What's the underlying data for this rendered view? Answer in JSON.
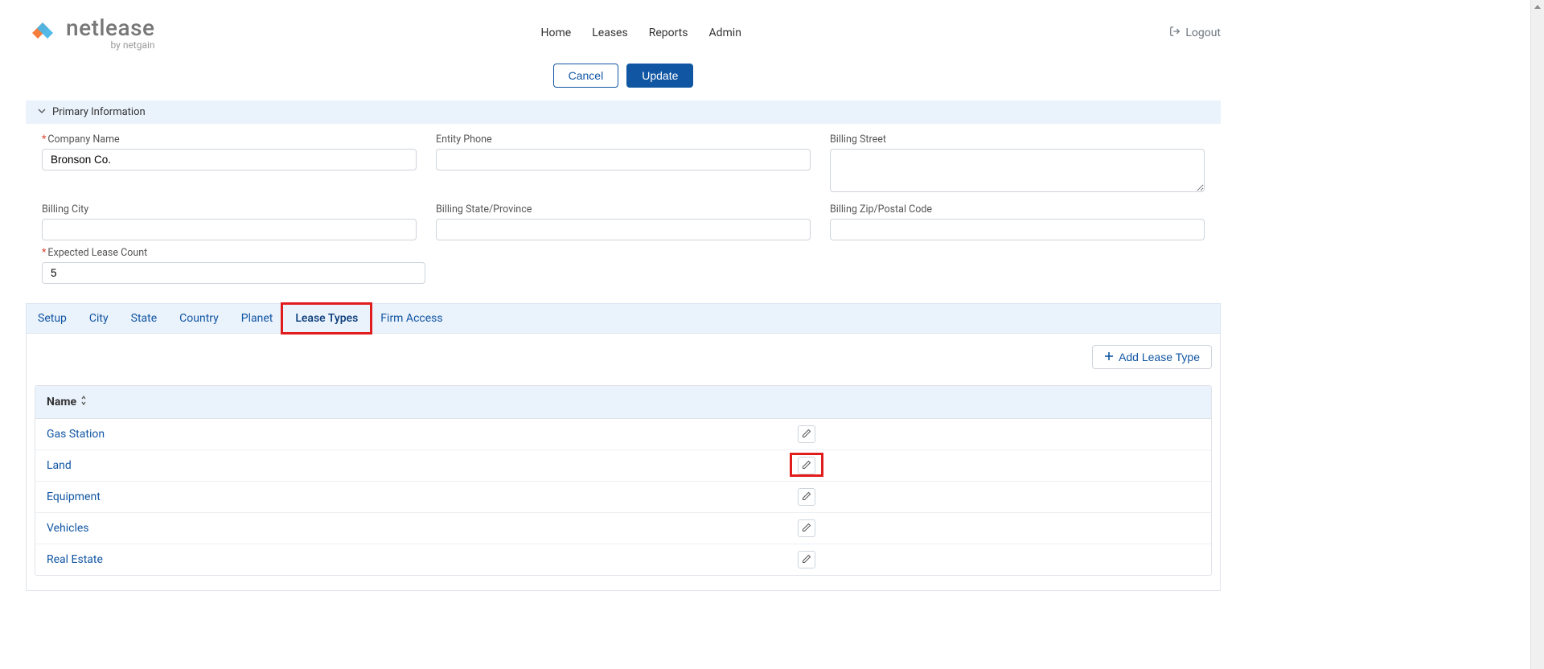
{
  "brand": {
    "name": "netlease",
    "by": "by netgain"
  },
  "nav": {
    "home": "Home",
    "leases": "Leases",
    "reports": "Reports",
    "admin": "Admin",
    "logout": "Logout"
  },
  "actions": {
    "cancel": "Cancel",
    "update": "Update"
  },
  "section": {
    "primary": "Primary Information"
  },
  "form": {
    "company_label": "Company Name",
    "company_value": "Bronson Co.",
    "phone_label": "Entity Phone",
    "phone_value": "",
    "street_label": "Billing Street",
    "street_value": "",
    "city_label": "Billing City",
    "city_value": "",
    "state_label": "Billing State/Province",
    "state_value": "",
    "zip_label": "Billing Zip/Postal Code",
    "zip_value": "",
    "count_label": "Expected Lease Count",
    "count_value": "5"
  },
  "tabs": {
    "setup": "Setup",
    "city": "City",
    "state": "State",
    "country": "Country",
    "planet": "Planet",
    "lease_types": "Lease Types",
    "firm_access": "Firm Access"
  },
  "table": {
    "add_label": "Add Lease Type",
    "header_name": "Name",
    "rows": [
      {
        "name": "Gas Station"
      },
      {
        "name": "Land"
      },
      {
        "name": "Equipment"
      },
      {
        "name": "Vehicles"
      },
      {
        "name": "Real Estate"
      }
    ]
  }
}
